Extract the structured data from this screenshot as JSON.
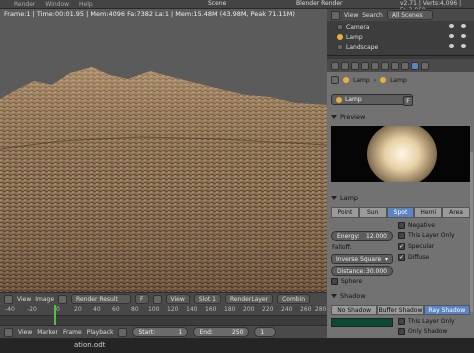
{
  "topbar": {
    "menus": [
      "Render",
      "Window",
      "Help"
    ],
    "scene": "Scene",
    "engine": "Blender Render",
    "version": "v2.71 | Verts:4,096 | Fa:3,969"
  },
  "render_info": "Frame:1 | Time:00:01.95 | Mem:4096 Fa:7382 La:1 | Mem:15.48M (43.98M, Peak 71.11M)",
  "image_header": {
    "view": "View",
    "image": "Image",
    "image_name": "Render Result",
    "f_label": "F",
    "view2": "View",
    "slot": "Slot 1",
    "layer": "RenderLayer",
    "combined": "Combin"
  },
  "timeline": {
    "ticks": [
      "-40",
      "-20",
      "0",
      "20",
      "40",
      "60",
      "80",
      "100",
      "120",
      "140",
      "160",
      "180",
      "200",
      "220",
      "240",
      "260",
      "280"
    ],
    "menus": [
      "View",
      "Marker",
      "Frame",
      "Playback"
    ],
    "start_label": "Start:",
    "start_value": "1",
    "end_label": "End:",
    "end_value": "250",
    "current": "1"
  },
  "status_text": "ation.odt",
  "outliner": {
    "view": "View",
    "search": "Search",
    "scenes": "All Scenes",
    "items": [
      "Camera",
      "Lamp",
      "Landscape"
    ]
  },
  "properties": {
    "breadcrumb_lamp1": "Lamp",
    "breadcrumb_lamp2": "Lamp",
    "lamp_name": "Lamp",
    "f_label": "F",
    "preview_title": "Preview",
    "lamp_title": "Lamp",
    "lamp_types": [
      "Point",
      "Sun",
      "Spot",
      "Hemi",
      "Area"
    ],
    "active_type": "Spot",
    "energy_label": "Energy:",
    "energy_value": "12.000",
    "falloff_label": "Falloff:",
    "falloff_value": "Inverse Square",
    "distance_label": "Distance:",
    "distance_value": "30.000",
    "sphere_label": "Sphere",
    "negative_label": "Negative",
    "this_layer_label": "This Layer Only",
    "specular_label": "Specular",
    "diffuse_label": "Diffuse",
    "shadow_title": "Shadow",
    "shadow_types": [
      "No Shadow",
      "Buffer Shadow",
      "Ray Shadow"
    ],
    "active_shadow": "Ray Shadow",
    "shadow_layer_label": "This Layer Only",
    "only_shadow_label": "Only Shadow"
  },
  "colors": {
    "accent": "#5a84c4",
    "terrain": "#a58867",
    "sky": "#5a5a5a",
    "shadow_color": "#0a4a34",
    "cursor": "#54c043"
  }
}
